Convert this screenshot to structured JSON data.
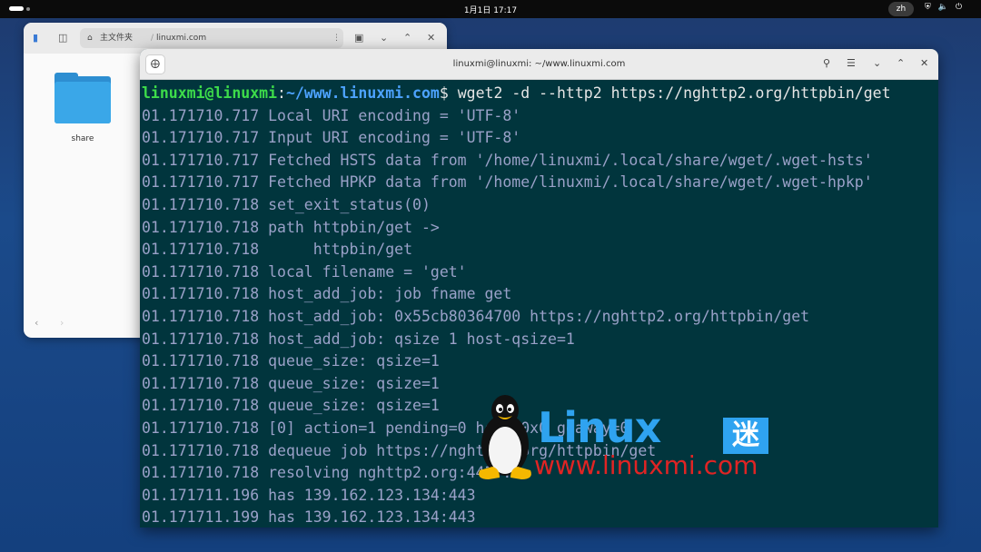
{
  "topbar": {
    "clock": "1月1日  17:17",
    "lang": "zh",
    "tray_icons": [
      "shield-icon",
      "volume-icon",
      "power-icon"
    ]
  },
  "files": {
    "breadcrumb_home": "主文件夹",
    "breadcrumb_current": "linuxmi.com",
    "folder_name": "share"
  },
  "terminal": {
    "title": "linuxmi@linuxmi: ~/www.linuxmi.com",
    "prompt": {
      "user": "linuxmi@linuxmi",
      "colon": ":",
      "path": "~/www.linuxmi.com",
      "dollar": "$ ",
      "command": "wget2 -d --http2 https://nghttp2.org/httpbin/get"
    },
    "lines": [
      "01.171710.717 Local URI encoding = 'UTF-8'",
      "01.171710.717 Input URI encoding = 'UTF-8'",
      "01.171710.717 Fetched HSTS data from '/home/linuxmi/.local/share/wget/.wget-hsts'",
      "01.171710.717 Fetched HPKP data from '/home/linuxmi/.local/share/wget/.wget-hpkp'",
      "01.171710.718 set_exit_status(0)",
      "01.171710.718 path httpbin/get ->",
      "01.171710.718      httpbin/get",
      "01.171710.718 local filename = 'get'",
      "01.171710.718 host_add_job: job fname get",
      "01.171710.718 host_add_job: 0x55cb80364700 https://nghttp2.org/httpbin/get",
      "01.171710.718 host_add_job: qsize 1 host-qsize=1",
      "01.171710.718 queue_size: qsize=1",
      "01.171710.718 queue_size: qsize=1",
      "01.171710.718 queue_size: qsize=1",
      "01.171710.718 [0] action=1 pending=0 host=0x0 goaway=0",
      "01.171710.718 dequeue job https://nghttp2.org/httpbin/get",
      "01.171710.718 resolving nghttp2.org:443...",
      "01.171711.196 has 139.162.123.134:443",
      "01.171711.199 has 139.162.123.134:443"
    ]
  },
  "watermark": {
    "brand": "Linux",
    "brand_char": "迷",
    "url": "www.linuxmi.com"
  },
  "colors": {
    "terminal_bg": "#01353d",
    "prompt_user": "#3ddc4a",
    "prompt_path": "#4da3ff",
    "output_text": "#9aa1c8",
    "watermark_blue": "#2fa3f0",
    "watermark_red": "#e02424"
  }
}
